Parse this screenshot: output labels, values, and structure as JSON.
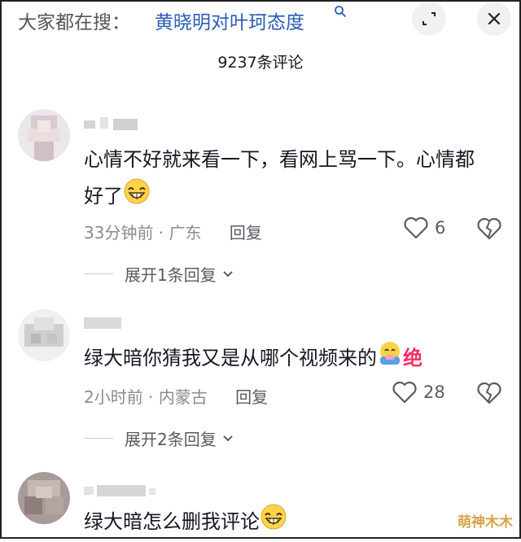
{
  "search_bar": {
    "prefix": "大家都在搜：",
    "query": "黄晓明对叶珂态度"
  },
  "comment_count": "9237条评论",
  "comments": [
    {
      "text": "心情不好就来看一下，看网上骂一下。心情都好了",
      "time": "33分钟前",
      "location": "广东",
      "reply_label": "回复",
      "likes": "6",
      "expand_label": "展开1条回复"
    },
    {
      "text": "绿大暗你猜我又是从哪个视频来的",
      "sticker_text": "绝",
      "time": "2小时前",
      "location": "内蒙古",
      "reply_label": "回复",
      "likes": "28",
      "expand_label": "展开2条回复"
    },
    {
      "text": "绿大暗怎么删我评论"
    }
  ],
  "watermark": "萌神木木",
  "colors": {
    "link": "#2b5db8",
    "meta": "#8a8b91",
    "accent_pink": "#ff2e63",
    "watermark": "#d3a548"
  }
}
